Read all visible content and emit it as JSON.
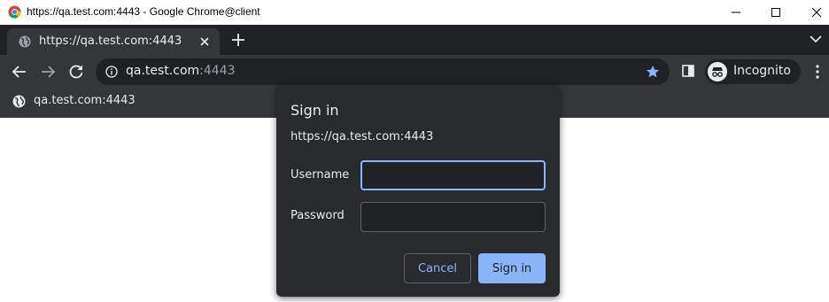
{
  "window": {
    "title": "https://qa.test.com:4443 - Google Chrome@client"
  },
  "tabs": [
    {
      "label": "https://qa.test.com:4443"
    }
  ],
  "omnibox": {
    "host": "qa.test.com",
    "port": ":4443"
  },
  "profile": {
    "label": "Incognito"
  },
  "infobar": {
    "site": "qa.test.com:4443"
  },
  "dialog": {
    "title": "Sign in",
    "origin": "https://qa.test.com:4443",
    "username_label": "Username",
    "username_value": "",
    "password_label": "Password",
    "password_value": "",
    "cancel_label": "Cancel",
    "signin_label": "Sign in"
  },
  "colors": {
    "tabstrip_bg": "#202124",
    "toolbar_bg": "#35363a",
    "dialog_bg": "#292a2d",
    "accent": "#8ab4f8",
    "text": "#e8eaed"
  }
}
